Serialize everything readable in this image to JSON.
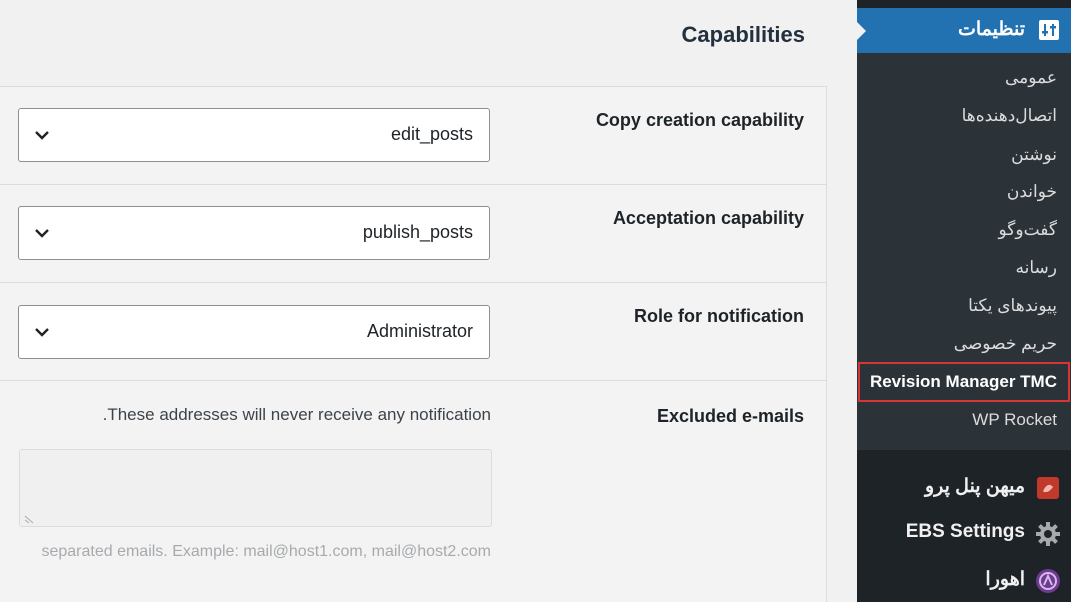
{
  "page": {
    "section_title": "Capabilities"
  },
  "settings": {
    "rows": [
      {
        "label": "Copy creation capability",
        "value": "edit_posts"
      },
      {
        "label": "Acceptation capability",
        "value": "publish_posts"
      },
      {
        "label": "Role for notification",
        "value": "Administrator"
      }
    ],
    "excluded": {
      "label": "Excluded e-mails",
      "description": ".These addresses will never receive any notification",
      "textarea_value": "",
      "hint": "separated emails. Example: mail@host1.com, mail@host2.com"
    }
  },
  "sidebar": {
    "settings_label": "تنظیمات",
    "settings_icon": "settings-sliders-icon",
    "submenu": [
      "عمومی",
      "اتصال‌دهنده‌ها",
      "نوشتن",
      "خواندن",
      "گفت‌وگو",
      "رسانه",
      "پیوندهای یکتا",
      "حریم خصوصی",
      "Revision Manager TMC",
      "WP Rocket"
    ],
    "current_submenu": "Revision Manager TMC",
    "menu": [
      {
        "label": "میهن پنل پرو",
        "icon": "mihan-panel-icon"
      },
      {
        "label": "EBS Settings",
        "icon": "gear-icon"
      },
      {
        "label": "اهورا",
        "icon": "ahura-icon"
      }
    ]
  },
  "colors": {
    "accent": "#2271b1",
    "sidebar_bg": "#1d2327",
    "submenu_bg": "#2c3338",
    "highlight": "#d63638"
  }
}
